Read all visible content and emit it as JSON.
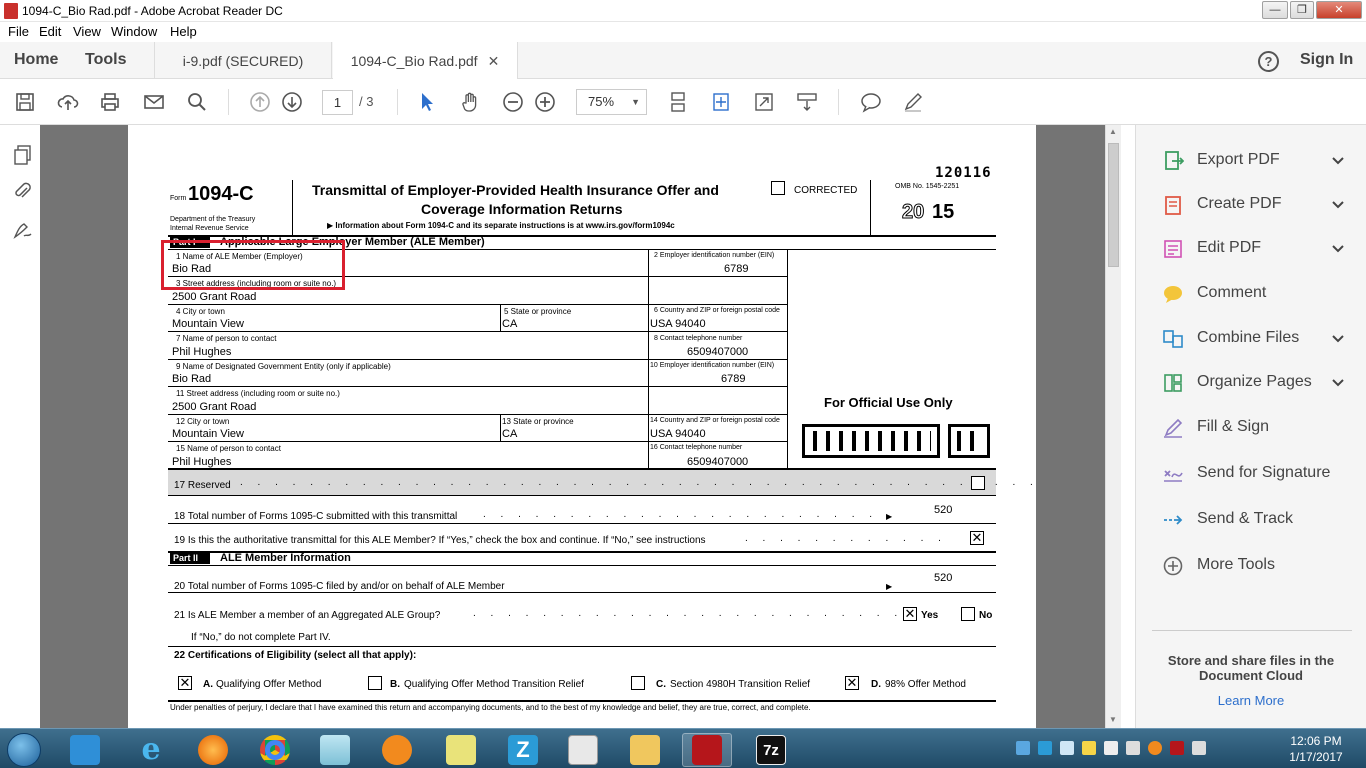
{
  "window": {
    "title": "1094-C_Bio Rad.pdf - Adobe Acrobat Reader DC"
  },
  "menu": [
    "File",
    "Edit",
    "View",
    "Window",
    "Help"
  ],
  "nav": {
    "home": "Home",
    "tools": "Tools",
    "sign_in": "Sign In"
  },
  "tabs": [
    {
      "label": "i-9.pdf (SECURED)"
    },
    {
      "label": "1094-C_Bio Rad.pdf"
    }
  ],
  "toolbar": {
    "page_current": "1",
    "page_total": "/ 3",
    "zoom": "75%"
  },
  "right_pane": {
    "items": [
      {
        "label": "Export PDF",
        "icon": "export-pdf-icon",
        "expandable": true,
        "color": "#3d9d62"
      },
      {
        "label": "Create PDF",
        "icon": "create-pdf-icon",
        "expandable": true,
        "color": "#e05a47"
      },
      {
        "label": "Edit PDF",
        "icon": "edit-pdf-icon",
        "expandable": true,
        "color": "#d052b4"
      },
      {
        "label": "Comment",
        "icon": "comment-icon",
        "expandable": false,
        "color": "#f3c53a"
      },
      {
        "label": "Combine Files",
        "icon": "combine-files-icon",
        "expandable": true,
        "color": "#2e8bc9"
      },
      {
        "label": "Organize Pages",
        "icon": "organize-pages-icon",
        "expandable": true,
        "color": "#3d9d62"
      },
      {
        "label": "Fill & Sign",
        "icon": "fill-sign-icon",
        "expandable": false,
        "color": "#8e7cc3"
      },
      {
        "label": "Send for Signature",
        "icon": "send-signature-icon",
        "expandable": false,
        "color": "#8e7cc3"
      },
      {
        "label": "Send & Track",
        "icon": "send-track-icon",
        "expandable": false,
        "color": "#2e8bc9"
      },
      {
        "label": "More Tools",
        "icon": "more-tools-icon",
        "expandable": false,
        "color": "#666666"
      }
    ],
    "cloud_text": "Store and share files in the Document Cloud",
    "learn_more": "Learn More"
  },
  "form": {
    "code": "120116",
    "form_word": "Form",
    "form_number": "1094-C",
    "dept1": "Department of the Treasury",
    "dept2": "Internal Revenue Service",
    "title1": "Transmittal of Employer-Provided Health Insurance Offer and",
    "title2": "Coverage Information Returns",
    "info": "▶ Information about Form 1094-C and its separate instructions is at www.irs.gov/form1094c",
    "corrected": "CORRECTED",
    "omb": "OMB No. 1545-2251",
    "year_a": "20",
    "year_b": "15",
    "part1_tag": "Part I",
    "part1_title": "Applicable Large Employer Member (ALE Member)",
    "l1": "1    Name of ALE Member (Employer)",
    "v1": "Bio Rad",
    "l2": "2  Employer identification number (EIN)",
    "v2": "6789",
    "l3": "3    Street address (including room or suite no.)",
    "v3": "2500 Grant Road",
    "l4": "4    City or town",
    "v4": "Mountain View",
    "l5": "5  State or province",
    "v5": "CA",
    "l6": "6  Country and ZIP or foreign postal code",
    "v6": "USA 94040",
    "l7": "7    Name of person to contact",
    "v7": "Phil Hughes",
    "l8": "8  Contact telephone number",
    "v8": "6509407000",
    "l9": "9    Name of Designated Government Entity (only if applicable)",
    "v9": "Bio Rad",
    "l10": "10  Employer identification number (EIN)",
    "v10": "6789",
    "l11": "11   Street address (including room or suite no.)",
    "v11": "2500 Grant Road",
    "l12": "12   City or town",
    "v12": "Mountain View",
    "l13": "13  State or province",
    "v13": "CA",
    "l14": "14  Country and ZIP or foreign postal code",
    "v14": "USA 94040",
    "l15": "15   Name of person to contact",
    "v15": "Phil Hughes",
    "l16": "16  Contact telephone number",
    "v16": "6509407000",
    "official": "For Official Use Only",
    "l17": "17   Reserved",
    "l18": "18   Total number of Forms 1095-C submitted with this transmittal",
    "v18": "520",
    "l19": "19   Is this the authoritative transmittal for this ALE Member? If “Yes,” check the box and continue. If “No,” see instructions",
    "part2_tag": "Part II",
    "part2_title": "ALE Member Information",
    "l20": "20   Total number of Forms 1095-C filed by and/or on behalf of ALE Member",
    "v20": "520",
    "l21": "21   Is ALE Member a member of an Aggregated ALE Group?",
    "yes": "Yes",
    "no": "No",
    "l21b": "If “No,” do not complete Part IV.",
    "l22": "22   Certifications of Eligibility (select all that apply):",
    "a_tag": "A.",
    "a_label": "Qualifying Offer Method",
    "b_tag": "B.",
    "b_label": "Qualifying Offer Method Transition Relief",
    "c_tag": "C.",
    "c_label": "Section 4980H Transition Relief",
    "d_tag": "D.",
    "d_label": "98% Offer Method",
    "perjury": "Under penalties of perjury, I declare that I have examined this return and accompanying documents, and to the best of my knowledge and belief, they are true, correct, and complete."
  },
  "taskbar": {
    "time": "12:06 PM",
    "date": "1/17/2017"
  }
}
